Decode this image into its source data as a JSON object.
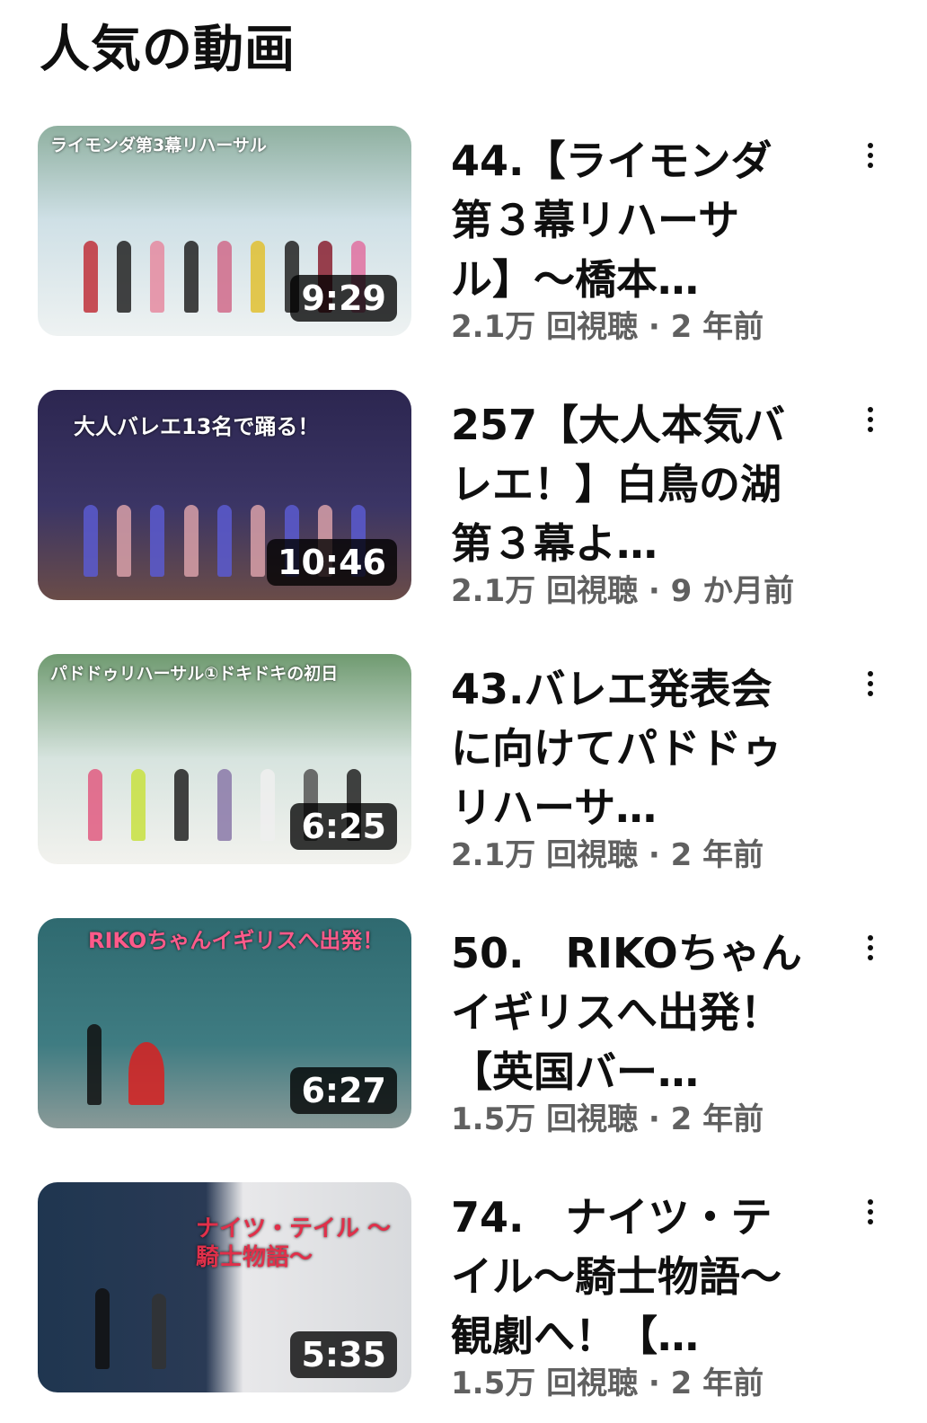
{
  "section": {
    "title": "人気の動画"
  },
  "videos": [
    {
      "thumb_caption": "ライモンダ第3幕リハーサル",
      "duration": "9:29",
      "title": "44.【ライモンダ第３幕リハーサル】〜橋本…",
      "meta": "2.1万 回視聴 · 2 年前",
      "thumb_color": "#cfe0e6"
    },
    {
      "thumb_caption": "大人バレエ13名で踊る！",
      "duration": "10:46",
      "title": "257【大人本気バレエ！】白鳥の湖第３幕よ…",
      "meta": "2.1万 回視聴 · 9 か月前",
      "thumb_color": "#3b3565"
    },
    {
      "thumb_caption": "パドドゥリハーサル①ドキドキの初日",
      "duration": "6:25",
      "title": "43.バレエ発表会に向けてパドドゥリハーサ…",
      "meta": "2.1万 回視聴 · 2 年前",
      "thumb_color": "#d7e4df"
    },
    {
      "thumb_caption": "RIKOちゃんイギリスへ出発！",
      "duration": "6:27",
      "title": "50.　RIKOちゃんイギリスへ出発！【英国バー…",
      "meta": "1.5万 回視聴 · 2 年前",
      "thumb_color": "#3f7c82"
    },
    {
      "thumb_caption": "ナイツ・テイル 〜騎士物語〜",
      "duration": "5:35",
      "title": "74.　ナイツ・テイル〜騎士物語〜観劇へ！【…",
      "meta": "1.5万 回視聴 · 2 年前",
      "thumb_color": "#1f3650"
    }
  ]
}
